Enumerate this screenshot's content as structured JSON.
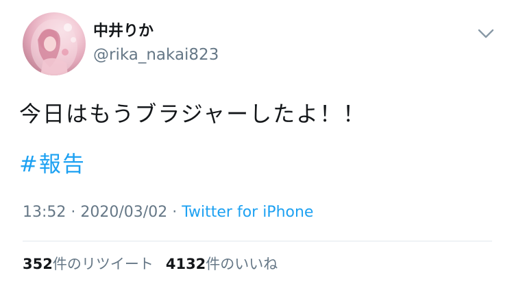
{
  "user": {
    "display_name": "中井りか",
    "username": "@rika_nakai823",
    "avatar_icon": "user-avatar-photo"
  },
  "header": {
    "menu_icon": "chevron-down-icon"
  },
  "tweet": {
    "text": "今日はもうブラジャーしたよ！！",
    "hashtag": "#報告"
  },
  "meta": {
    "time": "13:52",
    "separator_1": "·",
    "date": "2020/03/02",
    "separator_2": "·",
    "source": "Twitter for iPhone"
  },
  "stats": {
    "retweets_count": "352",
    "retweets_label": "件のリツイート",
    "likes_count": "4132",
    "likes_label": "件のいいね"
  },
  "colors": {
    "link": "#1da1f2",
    "secondary_text": "#657786",
    "primary_text": "#14171a",
    "divider": "#e1e8ed"
  }
}
